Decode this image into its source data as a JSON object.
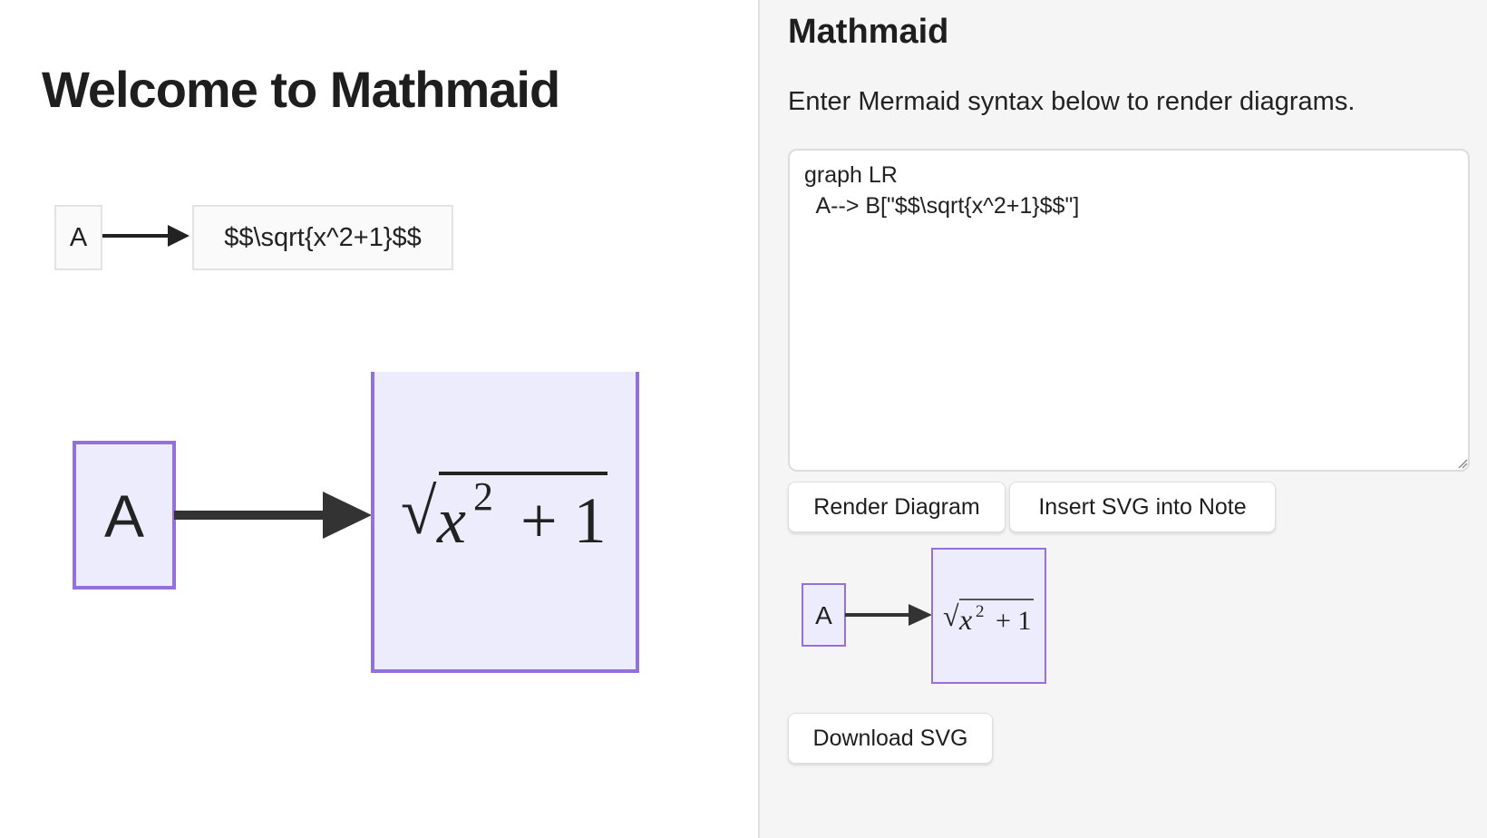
{
  "note": {
    "title": "Welcome to Mathmaid",
    "plain_diagram": {
      "node_a": "A",
      "node_b": "$$\\sqrt{x^2+1}$$"
    },
    "rendered_diagram": {
      "node_a": "A",
      "math": {
        "radical": "√",
        "base": "x",
        "exponent": "2",
        "rest": "+ 1"
      }
    }
  },
  "panel": {
    "title": "Mathmaid",
    "description": "Enter Mermaid syntax below to render diagrams.",
    "editor_value": "graph LR\n  A--> B[\"$$\\sqrt{x^2+1}$$\"]",
    "render_button": "Render Diagram",
    "insert_button": "Insert SVG into Note",
    "download_button": "Download SVG",
    "preview": {
      "node_a": "A",
      "math": {
        "radical": "√",
        "base": "x",
        "exponent": "2",
        "rest": "+ 1"
      }
    }
  },
  "colors": {
    "node_fill": "#ececfd",
    "node_stroke": "#9370db",
    "edge": "#333333",
    "panel_bg": "#f5f5f5"
  },
  "icons": {
    "arrow": "arrow-right-icon",
    "grip": "resize-grip-icon"
  }
}
